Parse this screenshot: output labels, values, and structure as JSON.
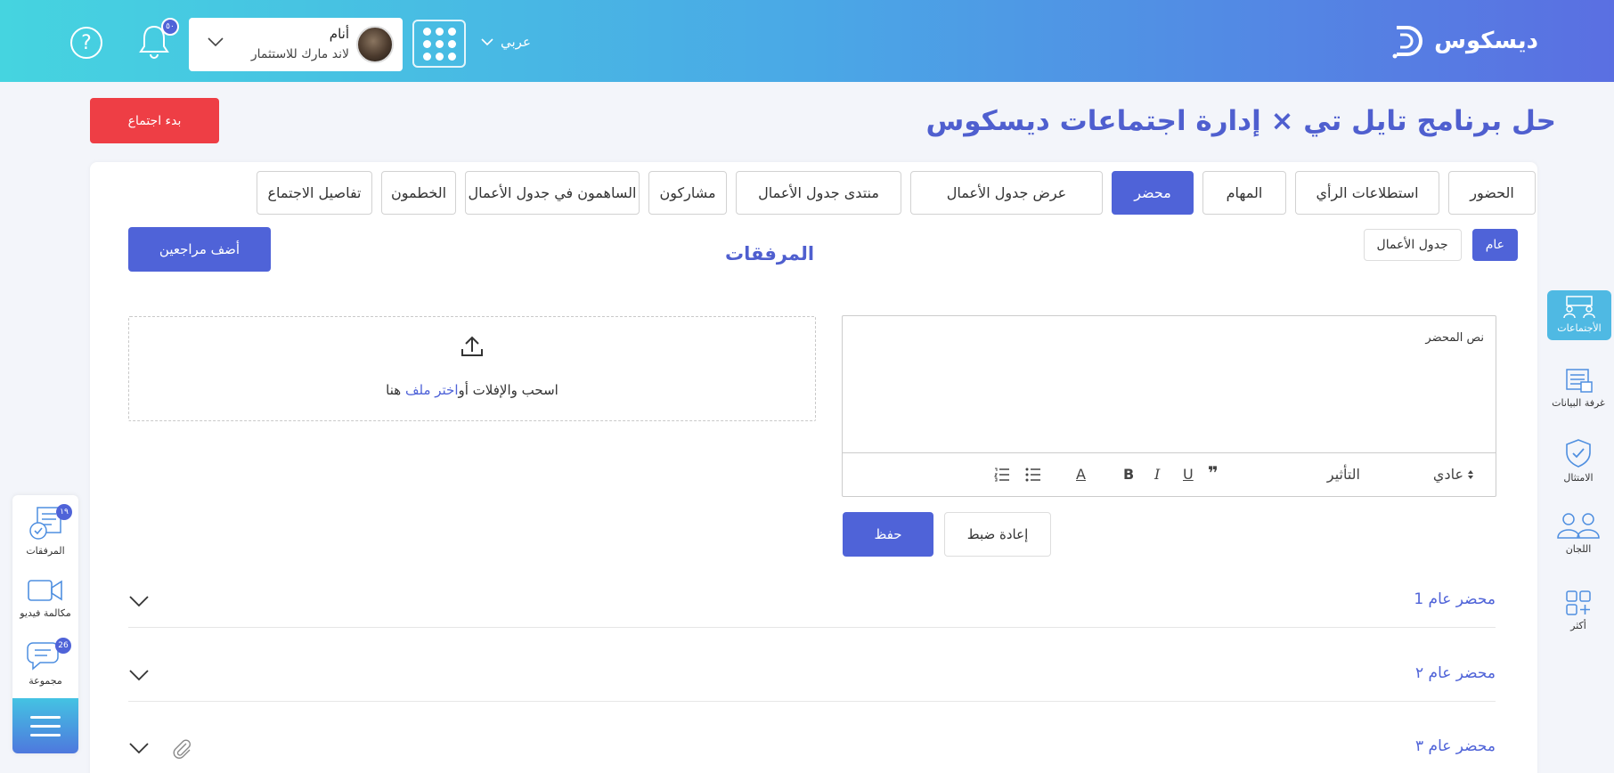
{
  "header": {
    "logo_text": "ديسكوس",
    "language": "عربي",
    "user_name": "أنام",
    "user_org": "لاند مارك للاستثمار",
    "notifications_count": "٥٠",
    "help_label": "?"
  },
  "sidebar_right": {
    "items": [
      {
        "label": "الأجتماعات",
        "icon": "meetings-icon",
        "active": true
      },
      {
        "label": "غرفة البيانات",
        "icon": "data-room-icon",
        "active": false
      },
      {
        "label": "الامتثال",
        "icon": "compliance-shield-icon",
        "active": false
      },
      {
        "label": "اللجان",
        "icon": "committees-icon",
        "active": false
      },
      {
        "label": "أكثر",
        "icon": "more-grid-icon",
        "active": false
      }
    ]
  },
  "sidebar_left": {
    "items": [
      {
        "label": "المرفقات",
        "badge": "١٩",
        "icon": "attachments-icon"
      },
      {
        "label": "مكالمة فيديو",
        "badge": "",
        "icon": "video-call-icon"
      },
      {
        "label": "مجموعة",
        "badge": "26",
        "icon": "group-chat-icon"
      }
    ]
  },
  "page": {
    "title": "حل برنامج تايل تي × إدارة اجتماعات ديسكوس",
    "start_meeting": "بدء اجتماع"
  },
  "tabs": [
    "تفاصيل الاجتماع",
    "الخطمون",
    "الساهمون في جدول الأعمال",
    "مشاركون",
    "منتدى جدول الأعمال",
    "عرض جدول الأعمال",
    "محضر",
    "المهام",
    "استطلاعات الرأي",
    "الحضور"
  ],
  "active_tab": "محضر",
  "subtabs": [
    "عام",
    "جدول الأعمال"
  ],
  "section": {
    "title": "المرفقات",
    "add_reviewers": "أضف مراجعين"
  },
  "dropzone": {
    "text": "اسحب والإفلات أو",
    "link": "اختر ملف",
    "suffix": " هنا"
  },
  "editor": {
    "placeholder": "نص المحضر",
    "format_select": "عادي",
    "effect_label": "التأثير",
    "toolbar": {
      "quote": "❞",
      "underline": "U",
      "italic": "I",
      "bold": "B",
      "color": "A"
    }
  },
  "actions": {
    "save": "حفظ",
    "reset": "إعادة ضبط"
  },
  "minutes": [
    {
      "title": "محضر عام 1",
      "has_attachment": false
    },
    {
      "title": "محضر عام ٢",
      "has_attachment": false
    },
    {
      "title": "محضر عام ٣",
      "has_attachment": true
    }
  ]
}
